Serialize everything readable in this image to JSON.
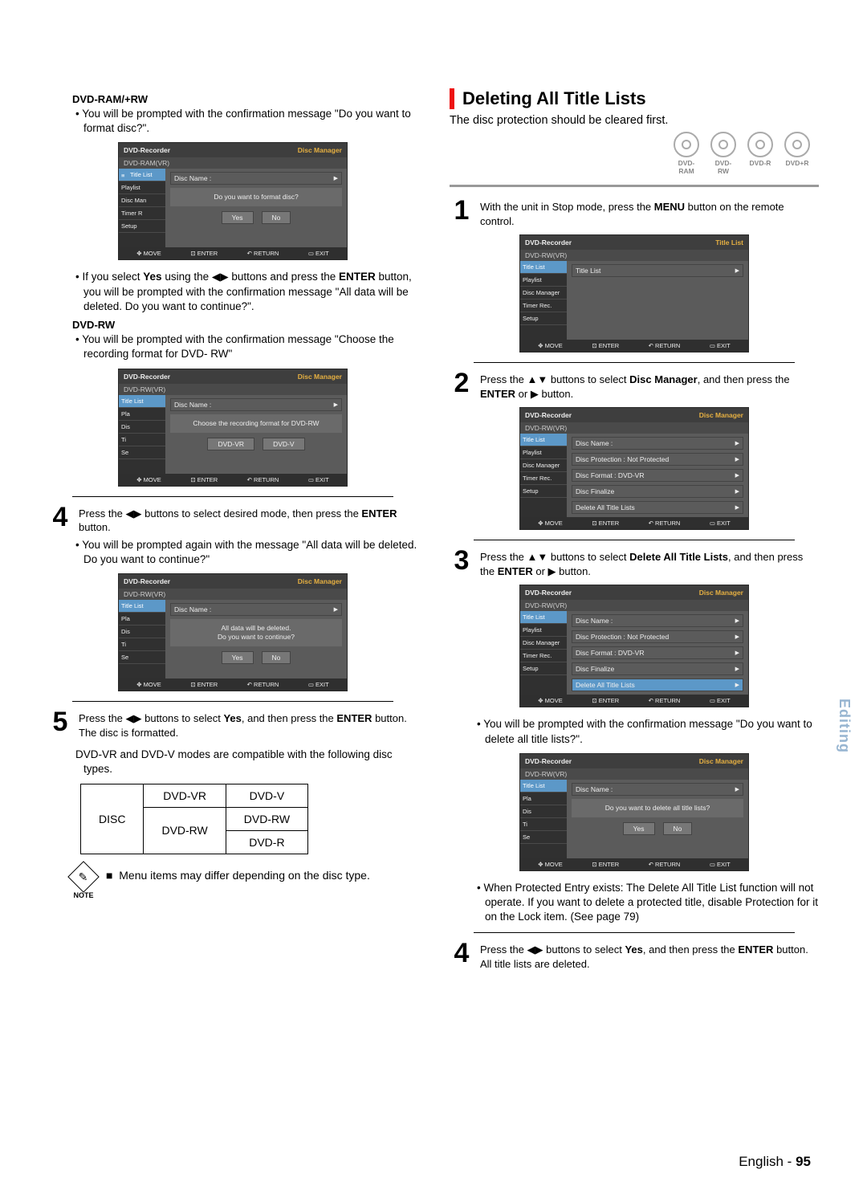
{
  "left": {
    "h1": "DVD-RAM/+RW",
    "p1": "You will be prompted with the confirmation message \"Do you want to format disc?\".",
    "osd1": {
      "title_l": "DVD-Recorder",
      "title_r": "Disc Manager",
      "sub": "DVD-RAM(VR)",
      "side": [
        "Title List",
        "Playlist",
        "Disc Man",
        "Timer R",
        "Setup"
      ],
      "side_hl": 0,
      "main_row": "Disc Name    :",
      "msg": "Do you want to format disc?",
      "btn1": "Yes",
      "btn2": "No",
      "foot": {
        "move": "MOVE",
        "enter": "ENTER",
        "return": "RETURN",
        "exit": "EXIT"
      }
    },
    "p2a": "If you select ",
    "p2b": "Yes",
    "p2c": " using the ",
    "p2d": " buttons and press the ",
    "p2e": "ENTER",
    "p2f": " button, you will be prompted with the confirmation message \"All data will be deleted. Do you want to continue?\".",
    "h2": "DVD-RW",
    "p3": "You will be prompted with the confirmation message \"Choose the recording format for DVD- RW\"",
    "osd2": {
      "title_l": "DVD-Recorder",
      "title_r": "Disc Manager",
      "sub": "DVD-RW(VR)",
      "side": [
        "Title List",
        "Pla",
        "Dis",
        "Ti",
        "Se"
      ],
      "side_hl": 0,
      "main_row": "Disc Name :",
      "msg": "Choose the recording format for DVD-RW",
      "btn1": "DVD-VR",
      "btn2": "DVD-V",
      "foot": {
        "move": "MOVE",
        "enter": "ENTER",
        "return": "RETURN",
        "exit": "EXIT"
      }
    },
    "step4a": "Press the ",
    "step4b": " buttons to select desired mode, then press the ",
    "step4c": "ENTER",
    "step4d": " button.",
    "p4": "You will be prompted again with the message \"All data will be deleted. Do you want to continue?\"",
    "osd3": {
      "title_l": "DVD-Recorder",
      "title_r": "Disc Manager",
      "sub": "DVD-RW(VR)",
      "side": [
        "Title List",
        "Pla",
        "Dis",
        "Ti",
        "Se"
      ],
      "side_hl": 0,
      "main_row": "Disc Name :",
      "msgA": "All data will be deleted.",
      "msgB": "Do you want to continue?",
      "btn1": "Yes",
      "btn2": "No",
      "foot": {
        "move": "MOVE",
        "enter": "ENTER",
        "return": "RETURN",
        "exit": "EXIT"
      }
    },
    "step5a": "Press the ",
    "step5b": " buttons to select ",
    "step5c": "Yes",
    "step5d": ", and then press the ",
    "step5e": "ENTER",
    "step5f": " button.",
    "step5g": "The disc is formatted.",
    "p5": "DVD-VR and DVD-V modes are compatible with the following disc types.",
    "table": {
      "r0c0": "DISC",
      "r0c1": "DVD-VR",
      "r0c2": "DVD-V",
      "r1c1": "DVD-RW",
      "r1c2": "DVD-RW",
      "r2c2": "DVD-R"
    },
    "note_icon": "✎",
    "note_label": "NOTE",
    "note_bullet": "■",
    "note_text": "Menu items may differ depending on the disc type."
  },
  "right": {
    "h2": "Deleting All Title Lists",
    "lead": "The disc protection should be cleared first.",
    "discs": [
      "DVD-RAM",
      "DVD-RW",
      "DVD-R",
      "DVD+R"
    ],
    "step1a": "With the unit in Stop mode, press the ",
    "step1b": "MENU",
    "step1c": " button on the remote control.",
    "osd1": {
      "title_l": "DVD-Recorder",
      "title_r": "Title List",
      "sub": "DVD-RW(VR)",
      "side": [
        "Title List",
        "Playlist",
        "Disc Manager",
        "Timer Rec.",
        "Setup"
      ],
      "side_hl": 0,
      "main_row": "Title List",
      "foot": {
        "move": "MOVE",
        "enter": "ENTER",
        "return": "RETURN",
        "exit": "EXIT"
      }
    },
    "step2a": "Press the ",
    "step2b": " buttons to select ",
    "step2c": "Disc Manager",
    "step2d": ", and then press the ",
    "step2e": "ENTER",
    "step2f": " or ",
    "step2g": " button.",
    "osd2": {
      "title_l": "DVD-Recorder",
      "title_r": "Disc Manager",
      "sub": "DVD-RW(VR)",
      "side": [
        "Title List",
        "Playlist",
        "Disc Manager",
        "Timer Rec.",
        "Setup"
      ],
      "side_hl": 0,
      "rows": [
        "Disc Name :",
        "Disc Protection : Not Protected",
        "Disc Format : DVD-VR",
        "Disc Finalize",
        "Delete All Title Lists"
      ],
      "foot": {
        "move": "MOVE",
        "enter": "ENTER",
        "return": "RETURN",
        "exit": "EXIT"
      }
    },
    "step3a": "Press the ",
    "step3b": " buttons to select ",
    "step3c": "Delete All Title Lists",
    "step3d": ", and then press the ",
    "step3e": "ENTER",
    "step3f": " or ",
    "step3g": " button.",
    "osd3": {
      "title_l": "DVD-Recorder",
      "title_r": "Disc Manager",
      "sub": "DVD-RW(VR)",
      "side": [
        "Title List",
        "Playlist",
        "Disc Manager",
        "Timer Rec.",
        "Setup"
      ],
      "side_hl": 0,
      "rows": [
        "Disc Name :",
        "Disc Protection : Not Protected",
        "Disc Format : DVD-VR",
        "Disc Finalize",
        "Delete All Title Lists"
      ],
      "hl_row": 4,
      "foot": {
        "move": "MOVE",
        "enter": "ENTER",
        "return": "RETURN",
        "exit": "EXIT"
      }
    },
    "p1": "You will be prompted with the confirmation message \"Do you want to delete all title lists?\".",
    "osd4": {
      "title_l": "DVD-Recorder",
      "title_r": "Disc Manager",
      "sub": "DVD-RW(VR)",
      "side": [
        "Title List",
        "Pla",
        "Dis",
        "Ti",
        "Se"
      ],
      "side_hl": 0,
      "main_row": "Disc Name :",
      "msg": "Do you want to delete all title lists?",
      "btn1": "Yes",
      "btn2": "No",
      "foot": {
        "move": "MOVE",
        "enter": "ENTER",
        "return": "RETURN",
        "exit": "EXIT"
      }
    },
    "p2": "When Protected Entry exists: The Delete All Title List function will not operate. If you want to delete a protected title, disable Protection for it on the Lock item. (See page 79)",
    "step4a": "Press the ",
    "step4b": " buttons to select ",
    "step4c": "Yes",
    "step4d": ", and then press the ",
    "step4e": "ENTER",
    "step4f": " button.",
    "step4g": "All title lists are deleted."
  },
  "side_tab": "Editing",
  "footer": {
    "a": "English - ",
    "b": "95"
  }
}
